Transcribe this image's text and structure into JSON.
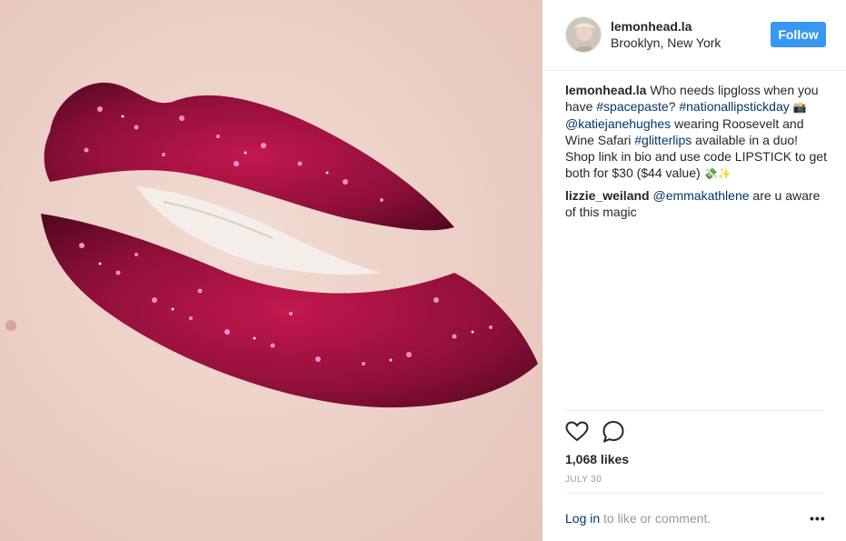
{
  "post": {
    "username": "lemonhead.la",
    "location": "Brooklyn, New York",
    "follow_label": "Follow",
    "image_subject": "glitter-lips-photo"
  },
  "caption": {
    "username": "lemonhead.la",
    "t1": " Who needs lipgloss when you have ",
    "h1": "#spacepaste",
    "t2": "? ",
    "h2": "#nationallipstickday",
    "t3": " ",
    "e1": "📸",
    "t4": " ",
    "m1": "@katiejanehughes",
    "t5": " wearing Roosevelt and Wine Safari ",
    "h3": "#glitterlips",
    "t6": " available in a duo! Shop link in bio and use code LIPSTICK to get both for $30 ($44 value) ",
    "e2": "💸✨"
  },
  "comments": [
    {
      "username": "lizzie_weiland",
      "space": " ",
      "mention": "@emmakathlene",
      "text": " are u aware of this magic"
    }
  ],
  "actions": {
    "like_icon": "heart-icon",
    "comment_icon": "comment-icon"
  },
  "likes": "1,068 likes",
  "date": "JULY 30",
  "footer": {
    "login_link": "Log in",
    "login_text": " to like or comment.",
    "more_label": "•••"
  },
  "colors": {
    "accent": "#3897f0",
    "link": "#003569",
    "muted": "#999999"
  }
}
